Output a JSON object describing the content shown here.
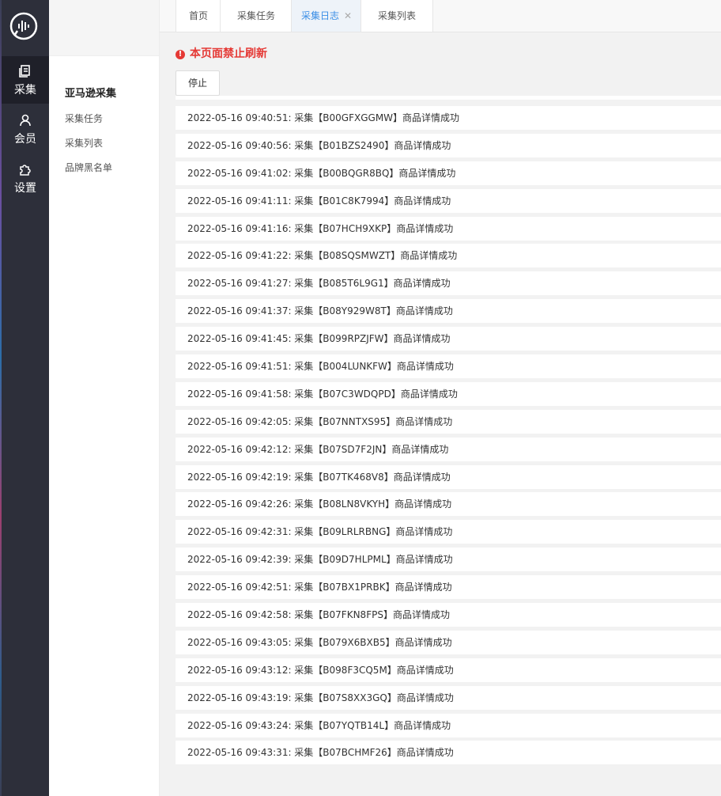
{
  "nav": {
    "items": [
      {
        "label": "采集",
        "icon": "copy-icon"
      },
      {
        "label": "会员",
        "icon": "user-icon"
      },
      {
        "label": "设置",
        "icon": "puzzle-icon"
      }
    ]
  },
  "sub_nav": {
    "title": "亚马逊采集",
    "items": [
      "采集任务",
      "采集列表",
      "品牌黑名单"
    ]
  },
  "tabs": [
    {
      "label": "首页"
    },
    {
      "label": "采集任务"
    },
    {
      "label": "采集日志",
      "closable": true
    },
    {
      "label": "采集列表"
    }
  ],
  "warning": "本页面禁止刷新",
  "stop_button": "停止",
  "logs": [
    "2022-05-16 09:40:51: 采集【B00GFXGGMW】商品详情成功",
    "2022-05-16 09:40:56: 采集【B01BZS2490】商品详情成功",
    "2022-05-16 09:41:02: 采集【B00BQGR8BQ】商品详情成功",
    "2022-05-16 09:41:11: 采集【B01C8K7994】商品详情成功",
    "2022-05-16 09:41:16: 采集【B07HCH9XKP】商品详情成功",
    "2022-05-16 09:41:22: 采集【B08SQSMWZT】商品详情成功",
    "2022-05-16 09:41:27: 采集【B085T6L9G1】商品详情成功",
    "2022-05-16 09:41:37: 采集【B08Y929W8T】商品详情成功",
    "2022-05-16 09:41:45: 采集【B099RPZJFW】商品详情成功",
    "2022-05-16 09:41:51: 采集【B004LUNKFW】商品详情成功",
    "2022-05-16 09:41:58: 采集【B07C3WDQPD】商品详情成功",
    "2022-05-16 09:42:05: 采集【B07NNTXS95】商品详情成功",
    "2022-05-16 09:42:12: 采集【B07SD7F2JN】商品详情成功",
    "2022-05-16 09:42:19: 采集【B07TK468V8】商品详情成功",
    "2022-05-16 09:42:26: 采集【B08LN8VKYH】商品详情成功",
    "2022-05-16 09:42:31: 采集【B09LRLRBNG】商品详情成功",
    "2022-05-16 09:42:39: 采集【B09D7HLPML】商品详情成功",
    "2022-05-16 09:42:51: 采集【B07BX1PRBK】商品详情成功",
    "2022-05-16 09:42:58: 采集【B07FKN8FPS】商品详情成功",
    "2022-05-16 09:43:05: 采集【B079X6BXB5】商品详情成功",
    "2022-05-16 09:43:12: 采集【B098F3CQ5M】商品详情成功",
    "2022-05-16 09:43:19: 采集【B07S8XX3GQ】商品详情成功",
    "2022-05-16 09:43:24: 采集【B07YQTB14L】商品详情成功",
    "2022-05-16 09:43:31: 采集【B07BCHMF26】商品详情成功"
  ],
  "colors": {
    "accent": "#3a8ee6",
    "warning": "#e53935",
    "nav_bg": "#2d2f3a"
  }
}
